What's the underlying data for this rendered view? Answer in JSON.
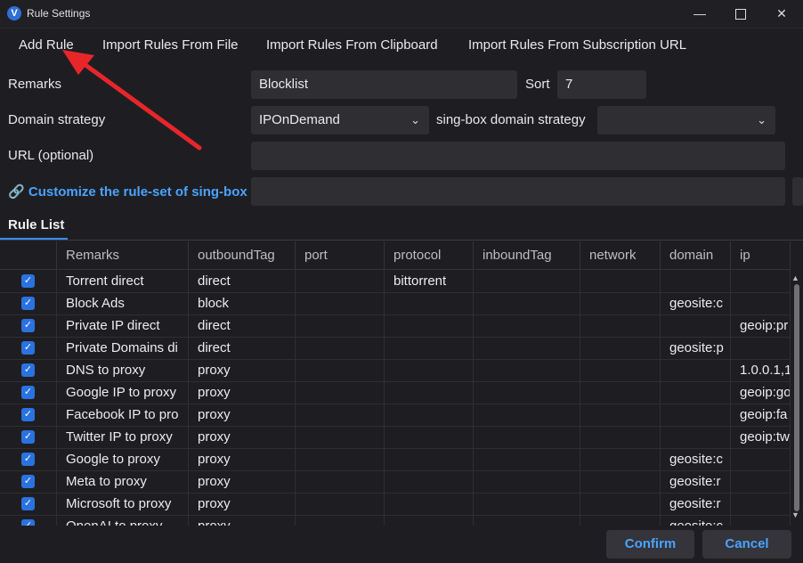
{
  "window": {
    "title": "Rule Settings",
    "app_icon": "v-logo-icon",
    "controls": {
      "minimize": "—",
      "close": "✕"
    }
  },
  "toolbar": {
    "add_rule": "Add Rule",
    "import_file": "Import Rules From File",
    "import_clipboard": "Import Rules From Clipboard",
    "import_subscription": "Import Rules From Subscription URL"
  },
  "form": {
    "remarks_label": "Remarks",
    "remarks_value": "Blocklist",
    "sort_label": "Sort",
    "sort_value": "7",
    "domain_strategy_label": "Domain strategy",
    "domain_strategy_value": "IPOnDemand",
    "singbox_domain_strategy_label": "sing-box domain strategy",
    "singbox_domain_strategy_value": "",
    "url_label": "URL (optional)",
    "url_value": "",
    "ruleset_link": "Customize the rule-set of sing-box",
    "ruleset_value": ""
  },
  "tabs": {
    "rule_list": "Rule List"
  },
  "table": {
    "columns": [
      "Remarks",
      "outboundTag",
      "port",
      "protocol",
      "inboundTag",
      "network",
      "domain",
      "ip"
    ],
    "rows": [
      {
        "remarks": "Torrent direct",
        "outbound": "direct",
        "port": "",
        "protocol": "bittorrent",
        "inbound": "",
        "network": "",
        "domain": "",
        "ip": ""
      },
      {
        "remarks": "Block Ads",
        "outbound": "block",
        "port": "",
        "protocol": "",
        "inbound": "",
        "network": "",
        "domain": "geosite:c",
        "ip": ""
      },
      {
        "remarks": "Private IP direct",
        "outbound": "direct",
        "port": "",
        "protocol": "",
        "inbound": "",
        "network": "",
        "domain": "",
        "ip": "geoip:pr"
      },
      {
        "remarks": "Private Domains di",
        "outbound": "direct",
        "port": "",
        "protocol": "",
        "inbound": "",
        "network": "",
        "domain": "geosite:p",
        "ip": ""
      },
      {
        "remarks": "DNS to proxy",
        "outbound": "proxy",
        "port": "",
        "protocol": "",
        "inbound": "",
        "network": "",
        "domain": "",
        "ip": "1.0.0.1,1"
      },
      {
        "remarks": "Google IP to proxy",
        "outbound": "proxy",
        "port": "",
        "protocol": "",
        "inbound": "",
        "network": "",
        "domain": "",
        "ip": "geoip:go"
      },
      {
        "remarks": "Facebook IP to pro",
        "outbound": "proxy",
        "port": "",
        "protocol": "",
        "inbound": "",
        "network": "",
        "domain": "",
        "ip": "geoip:fa"
      },
      {
        "remarks": "Twitter IP to proxy",
        "outbound": "proxy",
        "port": "",
        "protocol": "",
        "inbound": "",
        "network": "",
        "domain": "",
        "ip": "geoip:tw"
      },
      {
        "remarks": "Google to proxy",
        "outbound": "proxy",
        "port": "",
        "protocol": "",
        "inbound": "",
        "network": "",
        "domain": "geosite:c",
        "ip": ""
      },
      {
        "remarks": "Meta to proxy",
        "outbound": "proxy",
        "port": "",
        "protocol": "",
        "inbound": "",
        "network": "",
        "domain": "geosite:r",
        "ip": ""
      },
      {
        "remarks": "Microsoft to proxy",
        "outbound": "proxy",
        "port": "",
        "protocol": "",
        "inbound": "",
        "network": "",
        "domain": "geosite:r",
        "ip": ""
      },
      {
        "remarks": "OpenAI to proxy",
        "outbound": "proxy",
        "port": "",
        "protocol": "",
        "inbound": "",
        "network": "",
        "domain": "geosite:c",
        "ip": ""
      }
    ]
  },
  "buttons": {
    "confirm": "Confirm",
    "cancel": "Cancel"
  },
  "colors": {
    "accent": "#4aa3ff",
    "checkbox": "#2a72e0",
    "annotation_arrow": "#e8262a"
  }
}
